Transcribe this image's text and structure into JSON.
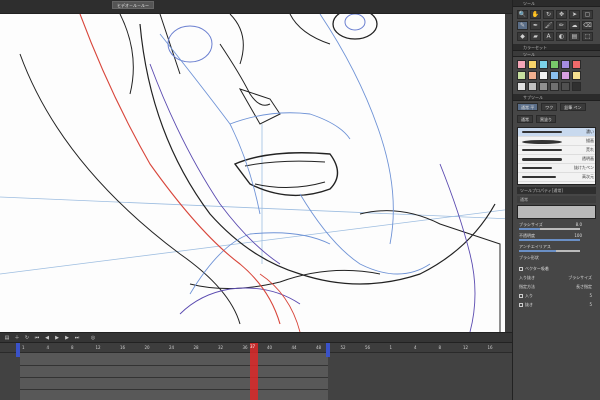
{
  "document_tab": "ヒデオ－ル－ルー",
  "tool_panel": {
    "title": "ツール",
    "tools": [
      "🔍",
      "✋",
      "↻",
      "✥",
      "➤",
      "▢",
      "✎",
      "✒",
      "🖌",
      "✏",
      "☁",
      "⌫",
      "◆",
      "▰",
      "A",
      "◐",
      "▤",
      "⬚"
    ]
  },
  "color_panel": {
    "title": "カラーセット",
    "subtitle": "ツール",
    "swatches": [
      "#f5a6b8",
      "#f7d46a",
      "#7ad1e8",
      "#78c86a",
      "#a58ce0",
      "#f06a6a",
      "#c8e0a0",
      "#f0b090",
      "#f2f2f2",
      "#8ac0f0",
      "#d8a0e0",
      "#f6e090",
      "#e0e0e0",
      "#c0c0c0",
      "#909090",
      "#707070",
      "#505050",
      "#303030"
    ]
  },
  "sub_tool": {
    "title": "サブツール",
    "buttons": [
      "通常 平",
      "ワク",
      "鉛筆 ペン",
      "通常",
      "黒塗り"
    ],
    "brushes": [
      "濃い",
      "描画",
      "荒れ",
      "透明画",
      "抜けたペン",
      "高次元",
      "細い"
    ]
  },
  "properties": {
    "title": "ツールプロパティ[通常]",
    "header": "通常",
    "rows": [
      {
        "label": "ブラシサイズ",
        "value": "8.0",
        "fill": 0.35
      },
      {
        "label": "不透明度",
        "value": "100",
        "fill": 1.0
      },
      {
        "label": "アンチエイリアス",
        "value": "",
        "fill": 0.6
      },
      {
        "label": "ブラシ形状",
        "value": "",
        "fill": 0.0
      }
    ],
    "checks": [
      {
        "label": "ベクター吸着"
      },
      {
        "label": "入り抜き",
        "extra": "ブラシサイズ"
      },
      {
        "label": "指定方法",
        "extra": "長さ指定"
      },
      {
        "label": "入り",
        "value": "5"
      },
      {
        "label": "抜き",
        "value": "5"
      }
    ]
  },
  "timeline": {
    "ticks": [
      "1",
      "4",
      "8",
      "12",
      "16",
      "20",
      "24",
      "28",
      "32",
      "36",
      "40",
      "44",
      "48",
      "52",
      "56",
      "1",
      "4",
      "8",
      "12",
      "16"
    ],
    "playhead_frame": "37"
  }
}
